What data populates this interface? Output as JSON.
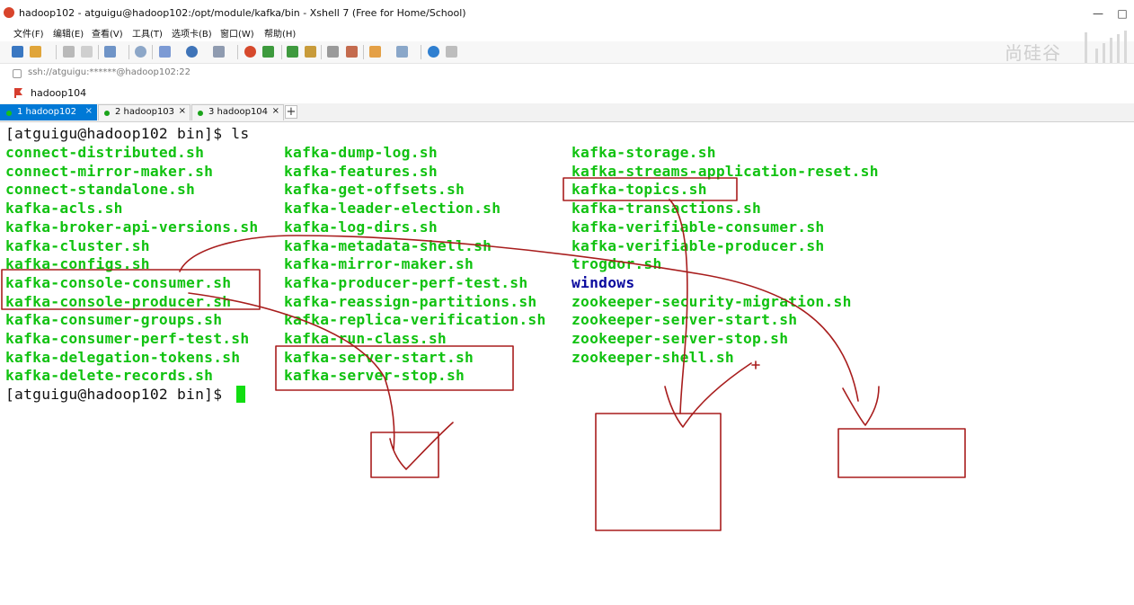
{
  "window": {
    "title": "hadoop102 - atguigu@hadoop102:/opt/module/kafka/bin - Xshell 7 (Free for Home/School)",
    "controls": [
      "—",
      "□",
      "✕"
    ]
  },
  "menu": [
    "文件(F)",
    "编辑(E)",
    "查看(V)",
    "工具(T)",
    "选项卡(B)",
    "窗口(W)",
    "帮助(H)"
  ],
  "watermark": "尚硅谷",
  "address": "ssh://atguigu:******@hadoop102:22",
  "session": "hadoop104",
  "tabs": [
    {
      "label": "1 hadoop102",
      "active": true
    },
    {
      "label": "2 hadoop103",
      "active": false
    },
    {
      "label": "3 hadoop104",
      "active": false
    }
  ],
  "tab_add_label": "+",
  "tab_close_label": "×",
  "terminal": {
    "prompt1": "[atguigu@hadoop102 bin]$ ls",
    "prompt2": "[atguigu@hadoop102 bin]$ ",
    "columns": [
      [
        "connect-distributed.sh",
        "connect-mirror-maker.sh",
        "connect-standalone.sh",
        "kafka-acls.sh",
        "kafka-broker-api-versions.sh",
        "kafka-cluster.sh",
        "kafka-configs.sh",
        "kafka-console-consumer.sh",
        "kafka-console-producer.sh",
        "kafka-consumer-groups.sh",
        "kafka-consumer-perf-test.sh",
        "kafka-delegation-tokens.sh",
        "kafka-delete-records.sh"
      ],
      [
        "kafka-dump-log.sh",
        "kafka-features.sh",
        "kafka-get-offsets.sh",
        "kafka-leader-election.sh",
        "kafka-log-dirs.sh",
        "kafka-metadata-shell.sh",
        "kafka-mirror-maker.sh",
        "kafka-producer-perf-test.sh",
        "kafka-reassign-partitions.sh",
        "kafka-replica-verification.sh",
        "kafka-run-class.sh",
        "kafka-server-start.sh",
        "kafka-server-stop.sh"
      ],
      [
        "kafka-storage.sh",
        "kafka-streams-application-reset.sh",
        "kafka-topics.sh",
        "kafka-transactions.sh",
        "kafka-verifiable-consumer.sh",
        "kafka-verifiable-producer.sh",
        "trogdor.sh",
        "windows",
        "zookeeper-security-migration.sh",
        "zookeeper-server-start.sh",
        "zookeeper-server-stop.sh",
        "zookeeper-shell.sh"
      ]
    ],
    "directory_entries": [
      "windows"
    ]
  },
  "colors": {
    "terminal_green": "#11c211",
    "directory_blue": "#0a0a9e",
    "annotation_red": "#a81d1d",
    "tab_active": "#0079d6"
  }
}
